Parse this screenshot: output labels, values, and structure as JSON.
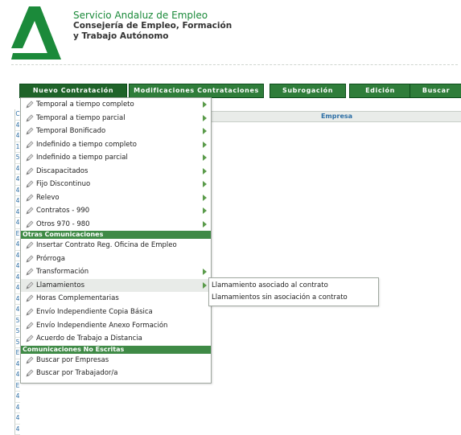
{
  "org": {
    "name": "Servicio Andaluz de Empleo",
    "dept_line1": "Consejería de Empleo, Formación",
    "dept_line2": "y Trabajo Autónomo",
    "brand_color": "#1b8a3a"
  },
  "menubar": {
    "items": [
      {
        "label": "Nuevo Contratación"
      },
      {
        "label": "Modificaciones Contrataciones"
      },
      {
        "label": "Subrogación"
      },
      {
        "label": "Edición"
      },
      {
        "label": "Buscar"
      }
    ]
  },
  "table": {
    "column_header": "Empresa",
    "gutter_rows": [
      "C",
      "4",
      "4",
      "1",
      "5",
      "4",
      "4",
      "4",
      "4",
      "4",
      "4",
      "E",
      "4",
      "4",
      "4",
      "4",
      "4",
      "4",
      "4",
      "5",
      "5",
      "5",
      "E",
      "4",
      "4",
      "E",
      "4",
      "4",
      "4",
      "4"
    ]
  },
  "dropdown": {
    "items_group1": [
      {
        "label": "Temporal a tiempo completo",
        "has_submenu": true
      },
      {
        "label": "Temporal a tiempo parcial",
        "has_submenu": true
      },
      {
        "label": "Temporal Bonificado",
        "has_submenu": true
      },
      {
        "label": "Indefinido a tiempo completo",
        "has_submenu": true
      },
      {
        "label": "Indefinido a tiempo parcial",
        "has_submenu": true
      },
      {
        "label": "Discapacitados",
        "has_submenu": true
      },
      {
        "label": "Fijo Discontinuo",
        "has_submenu": true
      },
      {
        "label": "Relevo",
        "has_submenu": true
      },
      {
        "label": "Contratos - 990",
        "has_submenu": true
      },
      {
        "label": "Otros 970 - 980",
        "has_submenu": true
      }
    ],
    "section_other": "Otras Comunicaciones",
    "items_group2": [
      {
        "label": "Insertar Contrato Reg. Oficina de Empleo",
        "has_submenu": false
      },
      {
        "label": "Prórroga",
        "has_submenu": false
      },
      {
        "label": "Transformación",
        "has_submenu": true
      },
      {
        "label": "Llamamientos",
        "has_submenu": true
      },
      {
        "label": "Horas Complementarias",
        "has_submenu": false
      },
      {
        "label": "Envío Independiente Copia Básica",
        "has_submenu": false
      },
      {
        "label": "Envío Independiente Anexo Formación",
        "has_submenu": false
      },
      {
        "label": "Acuerdo de Trabajo a Distancia",
        "has_submenu": false
      }
    ],
    "section_unwritten": "Comunicaciones No Escritas",
    "items_group3": [
      {
        "label": "Buscar por Empresas",
        "has_submenu": false
      },
      {
        "label": "Buscar por Trabajador/a",
        "has_submenu": false
      }
    ]
  },
  "submenu": {
    "items": [
      {
        "label": "Llamamiento asociado al contrato"
      },
      {
        "label": "Llamamientos sin asociación a contrato"
      }
    ]
  },
  "icons": {
    "menu_item": "pencil-icon",
    "submenu_arrow": "triangle-right-icon"
  }
}
